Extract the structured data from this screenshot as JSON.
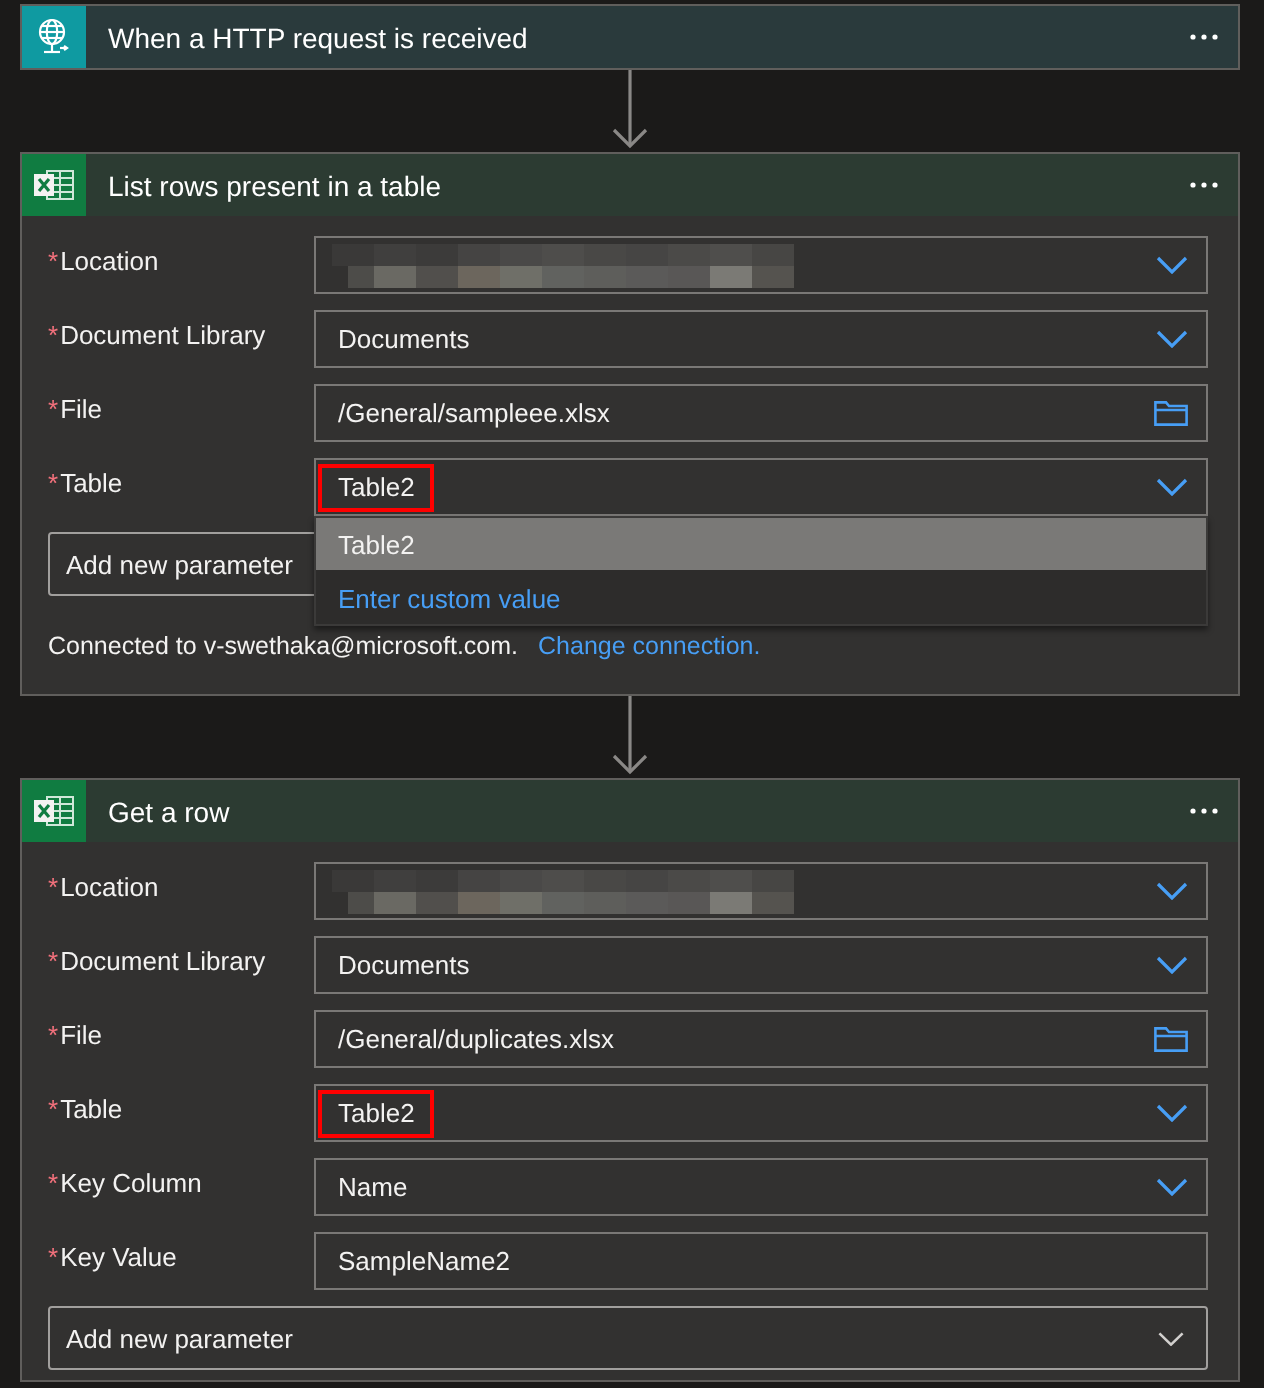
{
  "cards": [
    {
      "kind": "request",
      "title": "When a HTTP request is received"
    },
    {
      "kind": "excel",
      "title": "List rows present in a table",
      "fields": [
        {
          "required_mark": "*",
          "label": "Location",
          "kind": "dropdown",
          "redacted": true,
          "expanded": false
        },
        {
          "required_mark": "*",
          "label": "Document Library",
          "kind": "dropdown",
          "value": "Documents",
          "expanded": false
        },
        {
          "required_mark": "*",
          "label": "File",
          "kind": "file",
          "value": "/General/sampleee.xlsx"
        },
        {
          "required_mark": "*",
          "label": "Table",
          "kind": "dropdown",
          "value": "Table2",
          "highlighted": true,
          "expanded": true,
          "options": [
            {
              "kind": "option",
              "label": "Table2",
              "selected": true
            },
            {
              "kind": "custom",
              "label": "Enter custom value",
              "selected": false
            }
          ]
        }
      ],
      "add_parameter": {
        "label": "Add new parameter"
      },
      "connection": {
        "text": "Connected to v-swethaka@microsoft.com.",
        "link": "Change connection."
      }
    },
    {
      "kind": "excel",
      "title": "Get a row",
      "fields": [
        {
          "required_mark": "*",
          "label": "Location",
          "kind": "dropdown",
          "redacted": true,
          "expanded": false
        },
        {
          "required_mark": "*",
          "label": "Document Library",
          "kind": "dropdown",
          "value": "Documents",
          "expanded": false
        },
        {
          "required_mark": "*",
          "label": "File",
          "kind": "file",
          "value": "/General/duplicates.xlsx"
        },
        {
          "required_mark": "*",
          "label": "Table",
          "kind": "dropdown",
          "value": "Table2",
          "highlighted": true,
          "expanded": false
        },
        {
          "required_mark": "*",
          "label": "Key Column",
          "kind": "dropdown",
          "value": "Name",
          "expanded": false
        },
        {
          "required_mark": "*",
          "label": "Key Value",
          "kind": "text",
          "value": "SampleName2"
        }
      ],
      "add_parameter": {
        "label": "Add new parameter"
      }
    }
  ]
}
